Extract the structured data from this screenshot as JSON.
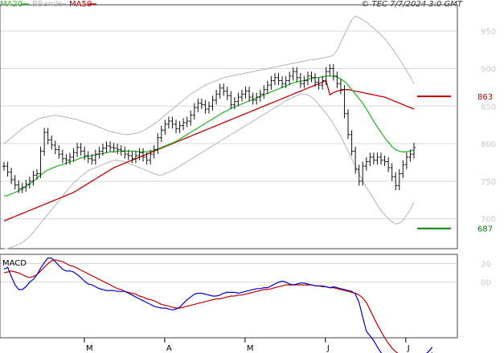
{
  "header": {
    "legend": [
      {
        "name": "MA20",
        "color": "#2eb82e"
      },
      {
        "name": "BBands",
        "color": "#b4b4b4"
      },
      {
        "name": "MA50",
        "color": "#c00000"
      }
    ],
    "copyright": "© TEC 7/7/2024 3:0 GMT"
  },
  "chart_data": [
    {
      "type": "ohlc",
      "title": "",
      "ylim": [
        660,
        985
      ],
      "yticks": [
        "700",
        "750",
        "800",
        "850",
        "900",
        "950"
      ],
      "xticks": [
        "M",
        "A",
        "M",
        "J",
        "J"
      ],
      "grid": true,
      "colors": {
        "price": "#111111",
        "ma20": "#2eb82e",
        "bbands": "#b4b4b4",
        "ma50": "#c00000"
      },
      "price_close": [
        770,
        762,
        752,
        745,
        740,
        742,
        746,
        750,
        758,
        760,
        790,
        815,
        805,
        798,
        792,
        786,
        780,
        778,
        782,
        788,
        795,
        790,
        784,
        780,
        778,
        786,
        790,
        794,
        797,
        795,
        794,
        792,
        790,
        786,
        784,
        780,
        784,
        788,
        782,
        778,
        786,
        792,
        808,
        818,
        826,
        830,
        826,
        820,
        824,
        828,
        830,
        838,
        848,
        854,
        852,
        846,
        850,
        858,
        866,
        874,
        870,
        864,
        852,
        856,
        862,
        866,
        870,
        862,
        858,
        862,
        866,
        872,
        878,
        884,
        888,
        884,
        880,
        884,
        890,
        896,
        888,
        880,
        884,
        890,
        888,
        882,
        878,
        884,
        896,
        900,
        890,
        880,
        872,
        840,
        812,
        790,
        766,
        750,
        770,
        776,
        782,
        778,
        782,
        778,
        776,
        768,
        756,
        744,
        760,
        772,
        782,
        786,
        795
      ],
      "ma20": [
        730,
        731,
        733,
        735,
        737,
        740,
        743,
        746,
        750,
        754,
        758,
        762,
        765,
        767,
        769,
        771,
        772,
        774,
        776,
        777,
        779,
        781,
        782,
        783,
        784,
        785,
        786,
        787,
        788,
        789,
        789,
        790,
        790,
        790,
        790,
        790,
        790,
        789,
        789,
        789,
        790,
        791,
        793,
        795,
        797,
        799,
        801,
        803,
        806,
        809,
        812,
        815,
        818,
        821,
        824,
        827,
        830,
        833,
        836,
        839,
        842,
        844,
        847,
        849,
        851,
        853,
        855,
        857,
        859,
        861,
        863,
        865,
        867,
        869,
        871,
        873,
        875,
        877,
        879,
        881,
        882,
        883,
        884,
        886,
        887,
        888,
        888,
        889,
        890,
        890,
        890,
        889,
        886,
        883,
        878,
        872,
        866,
        860,
        854,
        846,
        838,
        830,
        822,
        815,
        808,
        802,
        796,
        792,
        790,
        789,
        789,
        790,
        792
      ],
      "bb_upper": [
        800,
        804,
        808,
        812,
        816,
        820,
        823,
        826,
        829,
        832,
        834,
        835,
        836,
        837,
        838,
        837,
        836,
        835,
        834,
        833,
        832,
        830,
        829,
        827,
        826,
        824,
        822,
        820,
        818,
        816,
        815,
        814,
        813,
        812,
        812,
        813,
        814,
        815,
        817,
        820,
        823,
        826,
        830,
        834,
        838,
        842,
        846,
        850,
        854,
        858,
        862,
        866,
        869,
        872,
        875,
        878,
        880,
        882,
        884,
        886,
        888,
        889,
        890,
        891,
        892,
        893,
        894,
        895,
        896,
        897,
        898,
        899,
        900,
        901,
        902,
        903,
        904,
        905,
        906,
        907,
        908,
        909,
        910,
        911,
        912,
        912,
        913,
        914,
        915,
        916,
        918,
        925,
        935,
        945,
        955,
        965,
        970,
        968,
        965,
        962,
        958,
        954,
        949,
        945,
        940,
        934,
        927,
        920,
        913,
        905,
        897,
        889,
        880
      ],
      "bb_lower": [
        660,
        660,
        662,
        664,
        666,
        668,
        672,
        676,
        682,
        688,
        694,
        700,
        706,
        712,
        718,
        724,
        730,
        736,
        742,
        748,
        752,
        756,
        760,
        764,
        766,
        768,
        770,
        772,
        774,
        776,
        778,
        778,
        777,
        776,
        774,
        772,
        770,
        768,
        766,
        764,
        762,
        760,
        758,
        758,
        760,
        762,
        764,
        767,
        770,
        773,
        776,
        779,
        782,
        785,
        788,
        791,
        794,
        797,
        800,
        803,
        806,
        809,
        812,
        815,
        818,
        821,
        824,
        827,
        830,
        833,
        836,
        839,
        842,
        845,
        848,
        851,
        854,
        857,
        860,
        862,
        864,
        866,
        866,
        865,
        862,
        858,
        852,
        846,
        840,
        834,
        826,
        818,
        810,
        800,
        790,
        780,
        770,
        760,
        750,
        742,
        734,
        726,
        718,
        711,
        705,
        700,
        696,
        693,
        694,
        698,
        705,
        712,
        722
      ],
      "ma50": [
        697,
        699,
        701,
        703,
        705,
        707,
        709,
        711,
        713,
        715,
        717,
        719,
        721,
        723,
        725,
        727,
        729,
        731,
        733,
        735,
        738,
        741,
        744,
        747,
        750,
        753,
        756,
        759,
        762,
        765,
        768,
        770,
        772,
        774,
        776,
        778,
        780,
        782,
        784,
        786,
        788,
        790,
        792,
        794,
        796,
        798,
        800,
        802,
        804,
        806,
        808,
        810,
        812,
        814,
        816,
        818,
        820,
        822,
        824,
        826,
        828,
        830,
        832,
        834,
        836,
        838,
        840,
        842,
        844,
        846,
        848,
        850,
        852,
        854,
        856,
        858,
        860,
        862,
        864,
        866,
        868,
        870,
        872,
        874,
        876,
        878,
        880,
        882,
        884,
        865,
        868,
        870,
        871,
        872,
        872,
        871,
        870,
        869,
        868,
        867,
        866,
        865,
        864,
        863,
        862,
        860,
        858,
        856,
        854,
        852,
        850,
        848,
        846
      ],
      "annotations": [
        {
          "label": "863",
          "value": 863,
          "color": "#c00000"
        },
        {
          "label": "687",
          "value": 687,
          "color": "#008000"
        }
      ]
    },
    {
      "type": "line",
      "title": "MACD",
      "ylim": [
        -60,
        30
      ],
      "yticks": [
        "20",
        "00"
      ],
      "grid": true,
      "colors": {
        "macd": "#0000c8",
        "signal": "#c00000"
      },
      "macd": [
        14,
        16,
        6,
        -3,
        -8,
        -8,
        -5,
        0,
        3,
        8,
        15,
        21,
        26,
        26,
        22,
        18,
        14,
        12,
        12,
        11,
        8,
        5,
        1,
        -2,
        -3,
        -5,
        -7,
        -8,
        -9,
        -9,
        -9,
        -10,
        -10,
        -10,
        -12,
        -14,
        -16,
        -18,
        -20,
        -22,
        -24,
        -26,
        -27,
        -28,
        -28,
        -29,
        -30,
        -29,
        -27,
        -23,
        -19,
        -16,
        -13,
        -12,
        -12,
        -13,
        -14,
        -15,
        -15,
        -14,
        -12,
        -11,
        -11,
        -11,
        -12,
        -11,
        -10,
        -9,
        -8,
        -7,
        -7,
        -6,
        -6,
        -4,
        -2,
        0,
        1,
        0,
        -2,
        -3,
        -2,
        -1,
        -1,
        -2,
        -3,
        -4,
        -4,
        -4,
        -5,
        -6,
        -5,
        -6,
        -7,
        -8,
        -9,
        -10,
        -13,
        -22,
        -38,
        -53,
        -58,
        -63,
        -70,
        -76,
        -80,
        -83,
        -85,
        -86,
        -87,
        -88,
        -89,
        -90,
        -91,
        -88,
        -82,
        -78,
        -75,
        -70
      ],
      "signal": [
        10,
        11,
        12,
        11,
        10,
        8,
        6,
        5,
        6,
        8,
        12,
        16,
        20,
        23,
        24,
        23,
        22,
        20,
        18,
        17,
        15,
        13,
        11,
        9,
        7,
        5,
        3,
        1,
        -1,
        -3,
        -5,
        -7,
        -8,
        -10,
        -11,
        -12,
        -13,
        -15,
        -16,
        -18,
        -19,
        -20,
        -22,
        -24,
        -25,
        -26,
        -27,
        -28,
        -28,
        -27,
        -26,
        -25,
        -24,
        -23,
        -22,
        -21,
        -20,
        -19,
        -18,
        -18,
        -17,
        -16,
        -15,
        -15,
        -14,
        -14,
        -13,
        -12,
        -11,
        -10,
        -9,
        -8,
        -8,
        -7,
        -6,
        -5,
        -4,
        -3,
        -3,
        -3,
        -3,
        -3,
        -3,
        -3,
        -3,
        -4,
        -4,
        -5,
        -5,
        -6,
        -6,
        -7,
        -8,
        -9,
        -10,
        -11,
        -12,
        -14,
        -17,
        -22,
        -30,
        -38,
        -46,
        -53,
        -60,
        -66,
        -71,
        -75,
        -78,
        -81,
        -84,
        -85,
        -86,
        -86,
        -84,
        -81,
        -79,
        -76
      ]
    }
  ]
}
